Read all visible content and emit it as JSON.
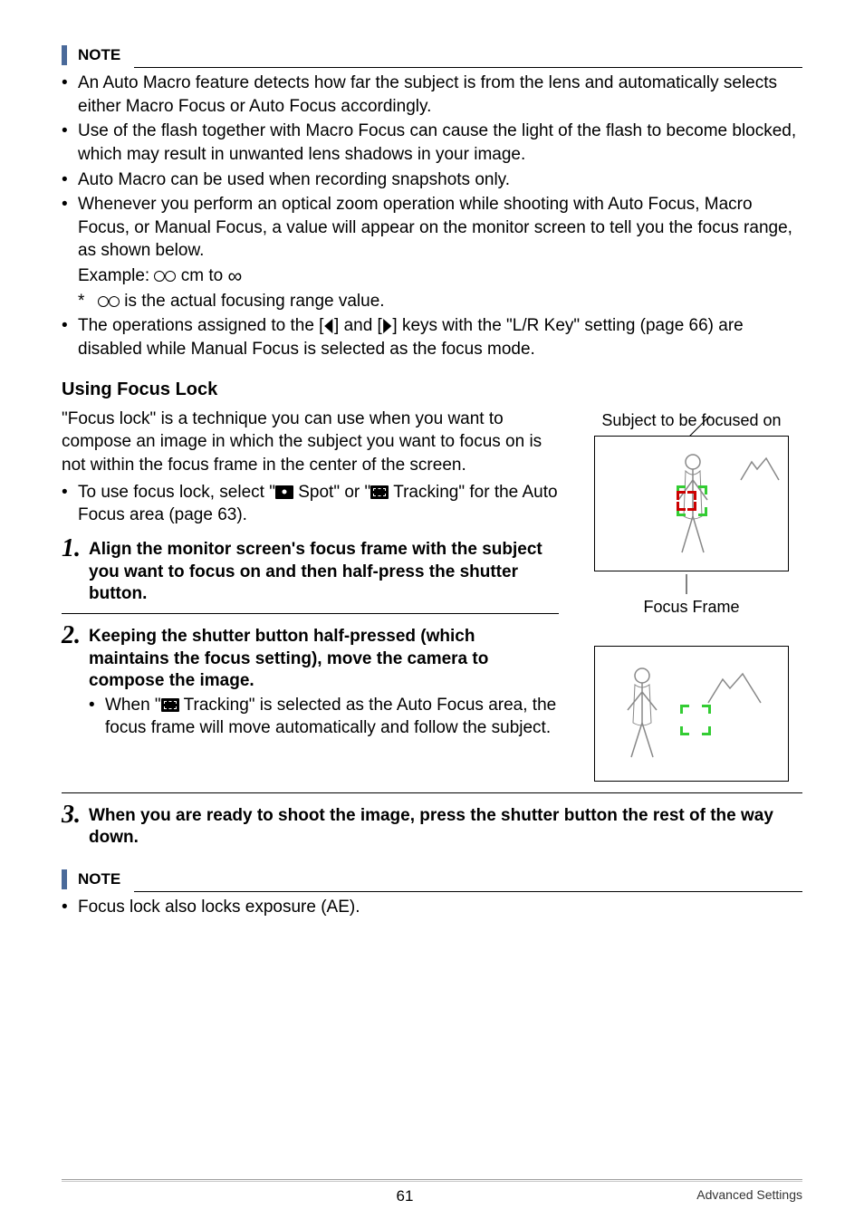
{
  "note_label": "NOTE",
  "notes1": [
    {
      "text": "An Auto Macro feature detects how far the subject is from the lens and automatically selects either Macro Focus or Auto Focus accordingly."
    },
    {
      "text": "Use of the flash together with Macro Focus can cause the light of the flash to become blocked, which may result in unwanted lens shadows in your image."
    },
    {
      "text": "Auto Macro can be used when recording snapshots only."
    },
    {
      "text": "Whenever you perform an optical zoom operation while shooting with Auto Focus, Macro Focus, or Manual Focus, a value will appear on the monitor screen to tell you the focus range, as shown below.",
      "example_prefix": "Example: ",
      "example_suffix": " cm to ",
      "star_text": " is the actual focusing range value."
    },
    {
      "lr_prefix": "The operations assigned to the [",
      "lr_mid": "] and [",
      "lr_suffix": "] keys with the \"L/R Key\" setting (page 66) are disabled while Manual Focus is selected as the focus mode."
    }
  ],
  "section_title": "Using Focus Lock",
  "intro": "\"Focus lock\" is a technique you can use when you want to compose an image in which the subject you want to focus on is not within the focus frame in the center of the screen.",
  "intro_bullet_pre": "To use focus lock, select \"",
  "intro_bullet_mid": " Spot\" or \"",
  "intro_bullet_post": " Tracking\" for the Auto Focus area (page 63).",
  "caption_subject": "Subject to be focused on",
  "caption_frame": "Focus Frame",
  "steps": [
    {
      "title": "Align the monitor screen's focus frame with the subject you want to focus on and then half-press the shutter button."
    },
    {
      "title": "Keeping the shutter button half-pressed (which maintains the focus setting), move the camera to compose the image.",
      "sub_pre": "When \"",
      "sub_post": " Tracking\" is selected as the Auto Focus area, the focus frame will move automatically and follow the subject."
    },
    {
      "title": "When you are ready to shoot the image, press the shutter button the rest of the way down."
    }
  ],
  "notes2": [
    {
      "text": "Focus lock also locks exposure (AE)."
    }
  ],
  "footer_page": "61",
  "footer_section": "Advanced Settings"
}
